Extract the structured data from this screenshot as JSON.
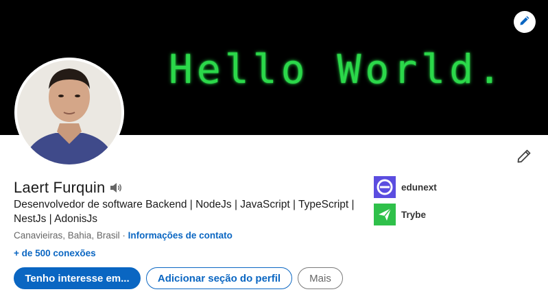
{
  "banner": {
    "text": "Hello World.",
    "background_color": "#000000",
    "text_color": "#2bd84a"
  },
  "icons": {
    "banner_edit": "pencil-icon",
    "profile_edit": "pencil-icon",
    "name_pronunciation": "speaker-icon",
    "edunext_logo": "edunext-logo",
    "trybe_logo": "trybe-logo"
  },
  "profile": {
    "name": "Laert Furquin",
    "headline": "Desenvolvedor de software Backend | NodeJs | JavaScript | TypeScript | NestJs | AdonisJs",
    "location": "Canavieiras, Bahia, Brasil",
    "separator": " · ",
    "contact_info_link": "Informações de contato",
    "connections": "+ de 500 conexões"
  },
  "actions": {
    "open_to": "Tenho interesse em...",
    "add_section": "Adicionar seção do perfil",
    "more": "Mais"
  },
  "organizations": [
    {
      "name": "edunext",
      "logo_color": "#5b4de0"
    },
    {
      "name": "Trybe",
      "logo_color": "#2fc04a"
    }
  ],
  "colors": {
    "primary": "#0a66c2",
    "text": "#1a1a1a",
    "muted": "#666666"
  }
}
